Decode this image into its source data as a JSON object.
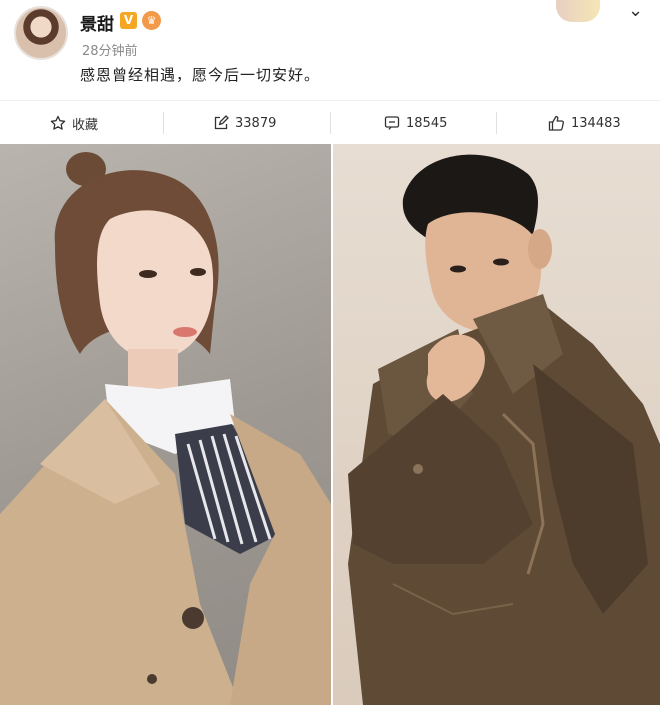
{
  "post": {
    "username": "景甜",
    "v_badge": "V",
    "level_badge": "♛",
    "time": "28分钟前",
    "text": "感恩曾经相遇，愿今后一切安好。"
  },
  "actions": {
    "favorite_label": "收藏",
    "repost_count": "33879",
    "comment_count": "18545",
    "like_count": "134483"
  },
  "icons": {
    "favorite": "star-outline-icon",
    "repost": "edit-share-icon",
    "comment": "comment-icon",
    "like": "thumbs-up-icon",
    "menu": "chevron-down-icon"
  },
  "colors": {
    "v_badge": "#f5a623",
    "level_badge": "#f2994a",
    "time_text": "#8a8a8a"
  }
}
